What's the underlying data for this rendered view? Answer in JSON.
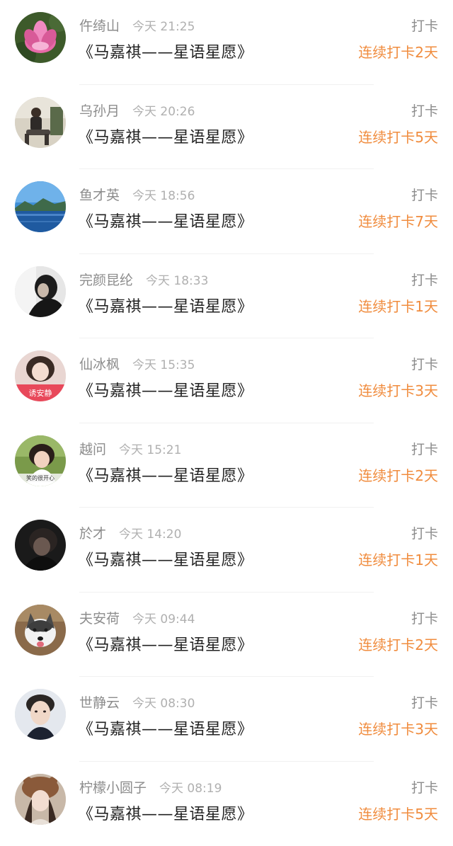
{
  "colors": {
    "accent": "#f08c3e",
    "name": "#8c8c8c",
    "time": "#b0b0b0",
    "title": "#222222"
  },
  "entries": [
    {
      "name": "仵绮山",
      "time": "今天 21:25",
      "title": "《马嘉祺——星语星愿》",
      "action": "打卡",
      "streak": "连续打卡2天",
      "avatar": "lotus-photo"
    },
    {
      "name": "乌孙月",
      "time": "今天 20:26",
      "title": "《马嘉祺——星语星愿》",
      "action": "打卡",
      "streak": "连续打卡5天",
      "avatar": "person-sitting-photo"
    },
    {
      "name": "鱼才英",
      "time": "今天 18:56",
      "title": "《马嘉祺——星语星愿》",
      "action": "打卡",
      "streak": "连续打卡7天",
      "avatar": "lake-landscape-photo"
    },
    {
      "name": "完颜昆纶",
      "time": "今天 18:33",
      "title": "《马嘉祺——星语星愿》",
      "action": "打卡",
      "streak": "连续打卡1天",
      "avatar": "dark-portrait-photo"
    },
    {
      "name": "仙冰枫",
      "time": "今天 15:35",
      "title": "《马嘉祺——星语星愿》",
      "action": "打卡",
      "streak": "连续打卡3天",
      "avatar": "girl-with-banner-photo",
      "avatar_text": "诱安静"
    },
    {
      "name": "越问",
      "time": "今天 15:21",
      "title": "《马嘉祺——星语星愿》",
      "action": "打卡",
      "streak": "连续打卡2天",
      "avatar": "smiling-girl-photo",
      "avatar_text": "笑的很开心"
    },
    {
      "name": "於才",
      "time": "今天 14:20",
      "title": "《马嘉祺——星语星愿》",
      "action": "打卡",
      "streak": "连续打卡1天",
      "avatar": "dark-face-photo"
    },
    {
      "name": "夫安荷",
      "time": "今天 09:44",
      "title": "《马嘉祺——星语星愿》",
      "action": "打卡",
      "streak": "连续打卡2天",
      "avatar": "husky-dog-photo"
    },
    {
      "name": "世静云",
      "time": "今天 08:30",
      "title": "《马嘉祺——星语星愿》",
      "action": "打卡",
      "streak": "连续打卡3天",
      "avatar": "man-portrait-photo"
    },
    {
      "name": "柠檬小圆子",
      "time": "今天 08:19",
      "title": "《马嘉祺——星语星愿》",
      "action": "打卡",
      "streak": "连续打卡5天",
      "avatar": "girl-with-hat-photo"
    }
  ]
}
